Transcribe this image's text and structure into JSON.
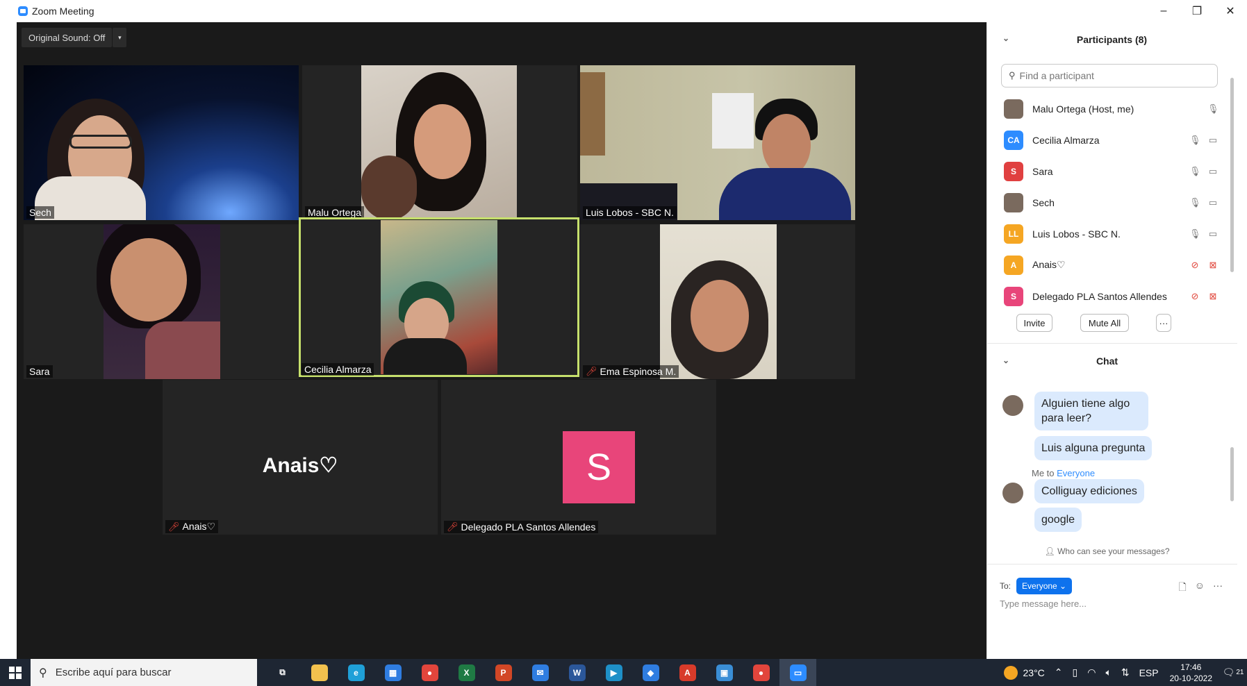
{
  "window": {
    "title": "Zoom Meeting",
    "controls": [
      "–",
      "❐",
      "✕"
    ]
  },
  "toolbar": {
    "original_sound": "Original Sound: Off",
    "caret": "▾"
  },
  "tiles": {
    "sech": "Sech",
    "malu": "Malu Ortega",
    "luis": "Luis Lobos - SBC N.",
    "sara": "Sara",
    "cecilia": "Cecilia Almarza",
    "ema": "Ema Espinosa M.",
    "anais_big": "Anais♡",
    "anais": "Anais♡",
    "delegado": "Delegado PLA Santos Allendes",
    "delegado_initial": "S"
  },
  "participants": {
    "title": "Participants (8)",
    "search_placeholder": "Find a participant",
    "list": [
      {
        "name": "Malu Ortega (Host, me)",
        "initials": "",
        "color": "#7a6a5e",
        "mic": "on",
        "cam": "none"
      },
      {
        "name": "Cecilia Almarza",
        "initials": "CA",
        "color": "#2d8cff",
        "mic": "on",
        "cam": "on"
      },
      {
        "name": "Sara",
        "initials": "S",
        "color": "#e04040",
        "mic": "on",
        "cam": "on"
      },
      {
        "name": "Sech",
        "initials": "",
        "color": "#7a6a5e",
        "mic": "on",
        "cam": "on"
      },
      {
        "name": "Luis Lobos - SBC N.",
        "initials": "LL",
        "color": "#f5a623",
        "mic": "on",
        "cam": "on"
      },
      {
        "name": "Anais♡",
        "initials": "A",
        "color": "#f5a623",
        "mic": "off",
        "cam": "off"
      },
      {
        "name": "Delegado PLA Santos Allendes",
        "initials": "S",
        "color": "#e8457a",
        "mic": "off",
        "cam": "off"
      }
    ],
    "invite": "Invite",
    "mute_all": "Mute All",
    "more": "···"
  },
  "chat": {
    "title": "Chat",
    "messages": [
      "Alguien tiene algo para leer?",
      "Luis alguna pregunta",
      "Colliguay ediciones",
      "google"
    ],
    "me_to": "Me to",
    "everyone_label": "Everyone",
    "who_can_see": "Who can see your messages?",
    "to_label": "To:",
    "to_value": "Everyone ⌄",
    "placeholder": "Type message here..."
  },
  "taskbar": {
    "search_placeholder": "Escribe aquí para buscar",
    "temperature": "23°C",
    "language": "ESP",
    "time": "17:46",
    "date": "20-10-2022",
    "notifications": "21",
    "apps": [
      {
        "name": "task-view",
        "color": "transparent",
        "label": "⧉"
      },
      {
        "name": "file-explorer",
        "color": "#f2c14e",
        "label": ""
      },
      {
        "name": "edge",
        "color": "#1fa0d8",
        "label": "e"
      },
      {
        "name": "store",
        "color": "#2f7de1",
        "label": "▦"
      },
      {
        "name": "chrome",
        "color": "#e2453c",
        "label": "●"
      },
      {
        "name": "excel",
        "color": "#1f7a44",
        "label": "X"
      },
      {
        "name": "powerpoint",
        "color": "#d24726",
        "label": "P"
      },
      {
        "name": "mail",
        "color": "#2f7de1",
        "label": "✉"
      },
      {
        "name": "word",
        "color": "#2b579a",
        "label": "W"
      },
      {
        "name": "media",
        "color": "#1e90c8",
        "label": "▶"
      },
      {
        "name": "paint",
        "color": "#2f7de1",
        "label": "◆"
      },
      {
        "name": "acrobat",
        "color": "#d83b2a",
        "label": "A"
      },
      {
        "name": "photos",
        "color": "#3a8ed6",
        "label": "▣"
      },
      {
        "name": "chrome-profile",
        "color": "#e2453c",
        "label": "●"
      },
      {
        "name": "zoom",
        "color": "#2d8cff",
        "label": "▭"
      }
    ]
  }
}
